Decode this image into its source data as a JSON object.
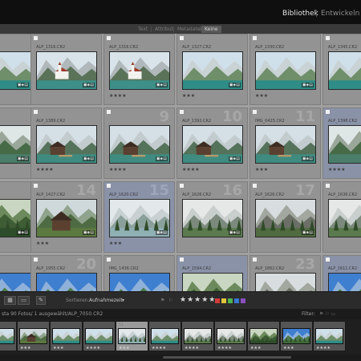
{
  "modules": {
    "library": "Bibliothek",
    "separator": "|",
    "develop": "Entwickeln"
  },
  "filterbar": {
    "items": [
      "Text",
      "Attribut",
      "Metadaten",
      "Keine"
    ],
    "active_index": 3
  },
  "grid": {
    "cells": [
      {
        "num": "",
        "file": "",
        "stars": "",
        "badges": "",
        "selected": false,
        "scene": "lake"
      },
      {
        "num": "",
        "file": "ALP_1316.CR2",
        "stars": "",
        "badges": "",
        "selected": false,
        "scene": "church"
      },
      {
        "num": "",
        "file": "ALP_1316.CR2",
        "stars": "★★★★",
        "badges": "",
        "selected": false,
        "scene": "church"
      },
      {
        "num": "",
        "file": "ALP_1327.CR2",
        "stars": "★★★",
        "badges": "",
        "selected": false,
        "scene": "lake"
      },
      {
        "num": "",
        "file": "ALP_1330.CR2",
        "stars": "★★★",
        "badges": "",
        "selected": false,
        "scene": "lake"
      },
      {
        "num": "",
        "file": "ALP_1345.CR2",
        "stars": "",
        "badges": "",
        "selected": false,
        "scene": "lake"
      },
      {
        "num": "",
        "file": "",
        "stars": "",
        "badges": "",
        "selected": false,
        "scene": "valley"
      },
      {
        "num": "",
        "file": "ALP_1389.CR2",
        "stars": "★★★★",
        "badges": "",
        "selected": false,
        "scene": "boathouse"
      },
      {
        "num": "9",
        "file": "",
        "stars": "★★★★",
        "badges": "",
        "selected": false,
        "scene": "boathouse"
      },
      {
        "num": "10",
        "file": "ALP_1392.CR2",
        "stars": "★★★★",
        "badges": "",
        "selected": false,
        "scene": "boathouse"
      },
      {
        "num": "11",
        "file": "IMG_0425.CR2",
        "stars": "★★★",
        "badges": "",
        "selected": false,
        "scene": "boathouse"
      },
      {
        "num": "12",
        "file": "ALP_1398.CR2",
        "stars": "★★★★",
        "badges": "",
        "selected": true,
        "scene": "valley"
      },
      {
        "num": "",
        "file": "",
        "stars": "",
        "badges": "",
        "selected": false,
        "scene": "forest"
      },
      {
        "num": "14",
        "file": "ALP_1427.CR2",
        "stars": "★★★",
        "badges": "",
        "selected": false,
        "scene": "hut"
      },
      {
        "num": "15",
        "file": "ALP_1620.CR2",
        "stars": "★★★",
        "badges": "",
        "selected": true,
        "scene": "island"
      },
      {
        "num": "16",
        "file": "ALP_1626.CR2",
        "stars": "",
        "badges": "",
        "selected": false,
        "scene": "mist"
      },
      {
        "num": "17",
        "file": "ALP_1626.CR2",
        "stars": "",
        "badges": "",
        "selected": false,
        "scene": "rock"
      },
      {
        "num": "18",
        "file": "ALP_1636.CR2",
        "stars": "",
        "badges": "",
        "selected": false,
        "scene": "mist"
      },
      {
        "num": "",
        "file": "",
        "stars": "",
        "badges": "",
        "selected": false,
        "scene": "sky"
      },
      {
        "num": "20",
        "file": "ALP_1955.CR2",
        "stars": "",
        "badges": "",
        "selected": false,
        "scene": "sky"
      },
      {
        "num": "",
        "file": "IMG_1436.CR2",
        "stars": "",
        "badges": "",
        "selected": false,
        "scene": "sky"
      },
      {
        "num": "",
        "file": "ALP_1594.CR2",
        "stars": "",
        "badges": "",
        "selected": true,
        "scene": "forest"
      },
      {
        "num": "23",
        "file": "ALP_1862.CR2",
        "stars": "",
        "badges": "",
        "selected": false,
        "scene": "rock"
      },
      {
        "num": "24",
        "file": "ALP_1611.CR2",
        "stars": "",
        "badges": "",
        "selected": true,
        "scene": "sky"
      }
    ]
  },
  "toolbar": {
    "sort_label": "Sortieren:",
    "sort_value": "Aufnahmezeit",
    "rating_stars": "★★★★★",
    "swatches": [
      "#d23a3a",
      "#e0c43a",
      "#4fb54f",
      "#3a78d2",
      "#8a4fc2"
    ]
  },
  "filmstrip_header": {
    "text": "sta   90 Fotos/ 1 ausgewählt/ALP_7050.CR2",
    "filter_label": "Filter:"
  },
  "filmstrip": {
    "cells": [
      {
        "num": "",
        "stars": "",
        "selected": false,
        "scene": "lake"
      },
      {
        "num": "",
        "stars": "★★★",
        "selected": false,
        "scene": "hut"
      },
      {
        "num": "",
        "stars": "★★★",
        "selected": false,
        "scene": "lake"
      },
      {
        "num": "",
        "stars": "★★★★",
        "selected": false,
        "scene": "lake"
      },
      {
        "num": "51",
        "stars": "★★★",
        "selected": true,
        "scene": "island"
      },
      {
        "num": "",
        "stars": "★★★★",
        "selected": false,
        "scene": "lake"
      },
      {
        "num": "",
        "stars": "★★★★",
        "selected": false,
        "scene": "mist"
      },
      {
        "num": "",
        "stars": "★★★★",
        "selected": false,
        "scene": "mist"
      },
      {
        "num": "",
        "stars": "★★★",
        "selected": false,
        "scene": "forest"
      },
      {
        "num": "",
        "stars": "★★★",
        "selected": false,
        "scene": "sky"
      },
      {
        "num": "",
        "stars": "★★★★",
        "selected": false,
        "scene": "lake"
      }
    ]
  }
}
